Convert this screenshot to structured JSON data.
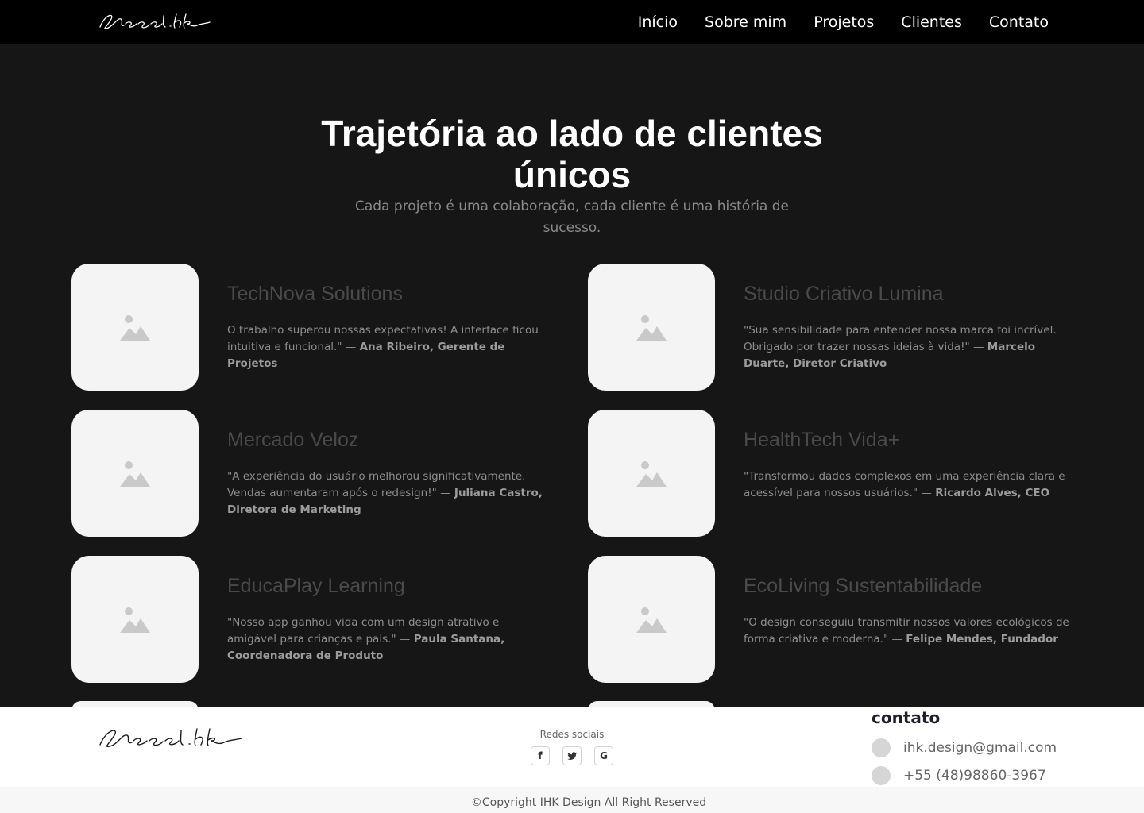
{
  "nav": {
    "logo_text": "Israel.hk",
    "links": [
      "Início",
      "Sobre mim",
      "Projetos",
      "Clientes",
      "Contato"
    ]
  },
  "hero": {
    "title_line1": "Trajetória ao lado de clientes",
    "title_line2": "únicos",
    "subtitle": "Cada projeto é uma colaboração, cada cliente é uma história de sucesso."
  },
  "clients": [
    {
      "name": "TechNova Solutions",
      "quote": "O trabalho superou nossas expectativas! A interface ficou intuitiva e funcional.\" —",
      "author": "Ana Ribeiro, Gerente de Projetos"
    },
    {
      "name": "Studio Criativo Lumina",
      "quote": "\"Sua sensibilidade para entender nossa marca foi incrível. Obrigado por trazer nossas ideias à vida!\" —",
      "author": "Marcelo Duarte, Diretor Criativo"
    },
    {
      "name": "Mercado Veloz",
      "quote": "\"A experiência do usuário melhorou significativamente. Vendas aumentaram após o redesign!\" —",
      "author": "Juliana Castro, Diretora de Marketing"
    },
    {
      "name": "HealthTech Vida+",
      "quote": "\"Transformou dados complexos em uma experiência clara e acessível para nossos usuários.\" —",
      "author": "Ricardo Alves, CEO"
    },
    {
      "name": "EducaPlay Learning",
      "quote": "\"Nosso app ganhou vida com um design atrativo e amigável para crianças e pais.\" —",
      "author": "Paula Santana, Coordenadora de Produto"
    },
    {
      "name": "EcoLiving Sustentabilidade",
      "quote": " \"O design conseguiu transmitir nossos valores ecológicos de forma criativa e moderna.\" —",
      "author": "Felipe Mendes, Fundador"
    }
  ],
  "footer": {
    "logo_text": "Israel.hk",
    "social_title": "Redes sociais",
    "social_icons": [
      "facebook-icon",
      "twitter-icon",
      "google-icon"
    ],
    "contact_title": "contato",
    "email": "ihk.design@gmail.com",
    "phone": "+55 (48)98860-3967",
    "copyright": "©Copyright IHK Design All Right Reserved"
  },
  "colors": {
    "background": "#161616",
    "navbar": "#000000",
    "thumb": "#f4f4f4",
    "footer": "#ffffff"
  }
}
